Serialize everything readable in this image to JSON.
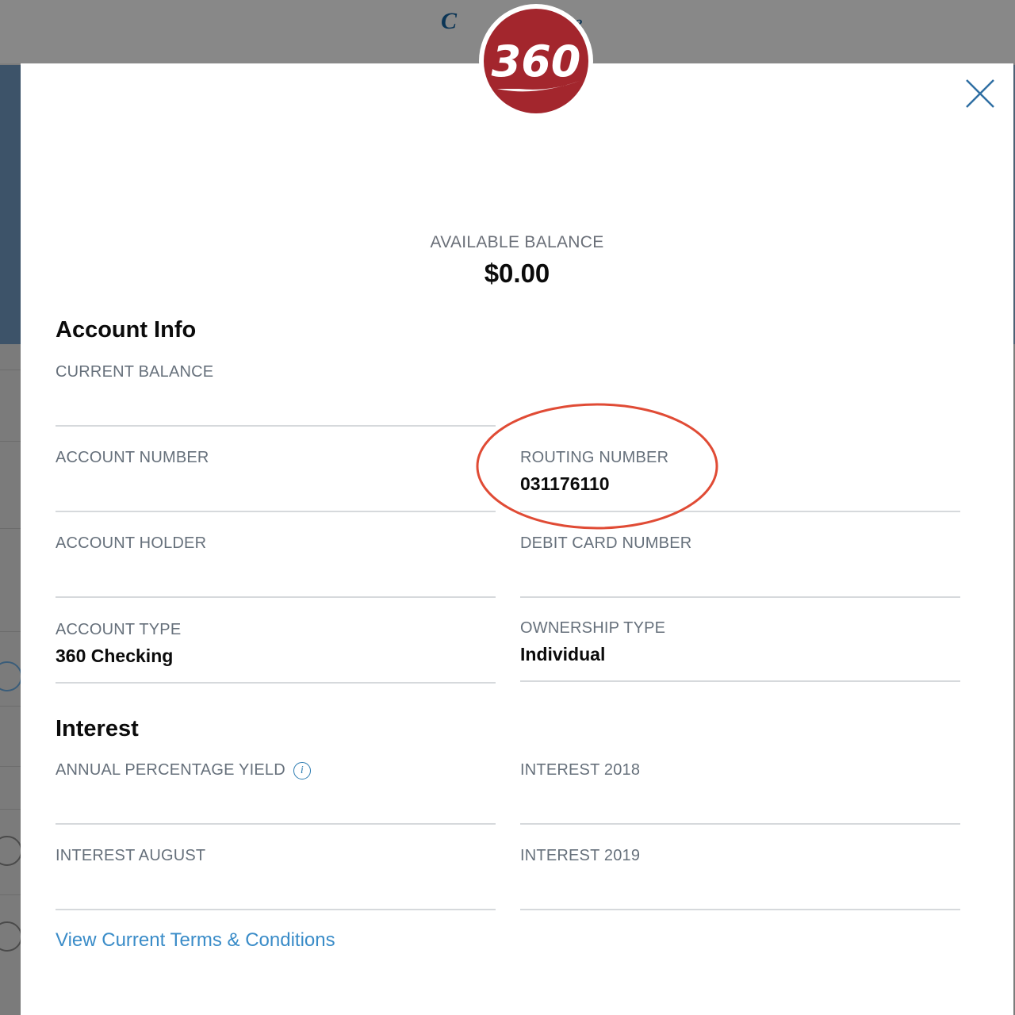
{
  "background": {
    "brand_text_left": "C",
    "brand_text_right": "ne"
  },
  "modal": {
    "logo_text": "360",
    "logo_color": "#a3262d",
    "close_icon": "close-icon",
    "available_balance_label": "AVAILABLE BALANCE",
    "available_balance_value": "$0.00",
    "account_info": {
      "title": "Account Info",
      "current_balance": {
        "label": "CURRENT BALANCE",
        "value": ""
      },
      "account_number": {
        "label": "ACCOUNT NUMBER",
        "value": ""
      },
      "routing_number": {
        "label": "ROUTING NUMBER",
        "value": "031176110"
      },
      "account_holder": {
        "label": "ACCOUNT HOLDER",
        "value": ""
      },
      "debit_card_number": {
        "label": "DEBIT CARD NUMBER",
        "value": ""
      },
      "account_type": {
        "label": "ACCOUNT TYPE",
        "value": "360 Checking"
      },
      "ownership_type": {
        "label": "OWNERSHIP TYPE",
        "value": "Individual"
      }
    },
    "interest": {
      "title": "Interest",
      "annual_percentage_yield": {
        "label": "ANNUAL PERCENTAGE YIELD",
        "value": "",
        "info_icon": "info-icon"
      },
      "interest_2018": {
        "label": "INTEREST 2018",
        "value": ""
      },
      "interest_august": {
        "label": "INTEREST AUGUST",
        "value": ""
      },
      "interest_2019": {
        "label": "INTEREST 2019",
        "value": ""
      }
    },
    "terms_link": "View Current Terms & Conditions",
    "annotation_color": "#e04b35",
    "link_color": "#3a8cc8"
  }
}
